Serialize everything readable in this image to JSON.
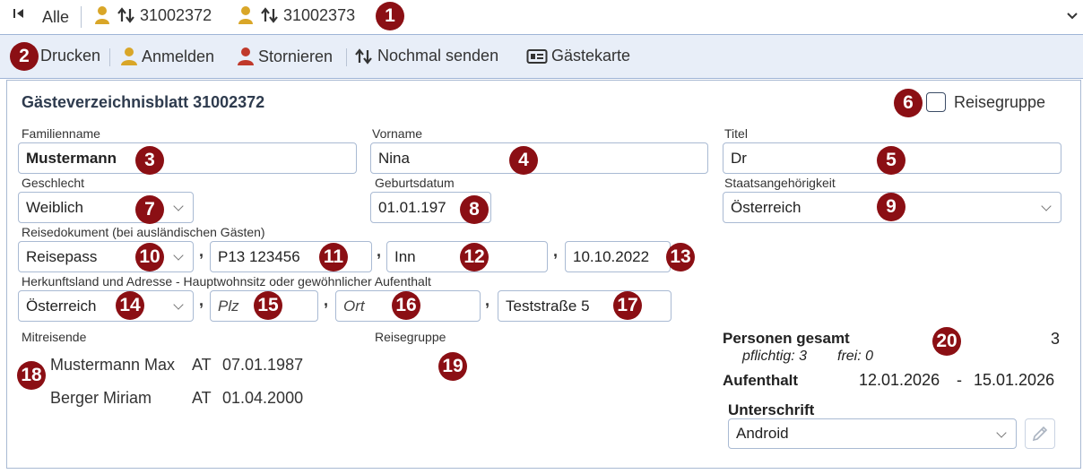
{
  "topbar": {
    "all_label": "Alle",
    "entries": [
      "31002372",
      "31002373"
    ]
  },
  "toolbar": {
    "print_label": "Drucken",
    "register_label": "Anmelden",
    "cancel_label": "Stornieren",
    "resend_label": "Nochmal senden",
    "guestcard_label": "Gästekarte"
  },
  "form": {
    "title": "Gästeverzeichnisblatt 31002372",
    "travel_group_checkbox_label": "Reisegruppe",
    "surname_label": "Familienname",
    "surname_value": "Mustermann",
    "firstname_label": "Vorname",
    "firstname_value": "Nina",
    "title_label": "Titel",
    "title_value": "Dr",
    "gender_label": "Geschlecht",
    "gender_value": "Weiblich",
    "birthdate_label": "Geburtsdatum",
    "birthdate_value": "01.01.197",
    "nationality_label": "Staatsangehörigkeit",
    "nationality_value": "Österreich",
    "document_label": "Reisedokument (bei ausländischen Gästen)",
    "document_type": "Reisepass",
    "document_number": "P13 123456",
    "document_issuer": "Inn",
    "document_date": "10.10.2022",
    "origin_label": "Herkunftsland und Adresse - Hauptwohnsitz oder gewöhnlicher Aufenthalt",
    "origin_country": "Österreich",
    "zip_placeholder": "Plz",
    "city_placeholder": "Ort",
    "street_value": "Teststraße 5"
  },
  "companions": {
    "label": "Mitreisende",
    "rows": [
      {
        "name": "Mustermann Max",
        "country": "AT",
        "date": "07.01.1987"
      },
      {
        "name": "Berger Miriam",
        "country": "AT",
        "date": "01.04.2000"
      }
    ]
  },
  "travel_group": {
    "label": "Reisegruppe"
  },
  "summary": {
    "persons_label": "Personen gesamt",
    "persons_total": "3",
    "obligatory": "pflichtig: 3",
    "free": "frei: 0",
    "stay_label": "Aufenthalt",
    "stay_from": "12.01.2026",
    "stay_dash": "-",
    "stay_to": "15.01.2026",
    "signature_label": "Unterschrift",
    "signature_value": "Android"
  },
  "markers": [
    "1",
    "2",
    "3",
    "4",
    "5",
    "6",
    "7",
    "8",
    "9",
    "10",
    "11",
    "12",
    "13",
    "14",
    "15",
    "16",
    "17",
    "18",
    "19",
    "20"
  ],
  "colors": {
    "marker": "#8b0f14",
    "user_icon_yellow": "#d9a628",
    "user_icon_red": "#c0392b",
    "toolbar_bg": "#e8eef8",
    "border": "#a9bad3"
  }
}
